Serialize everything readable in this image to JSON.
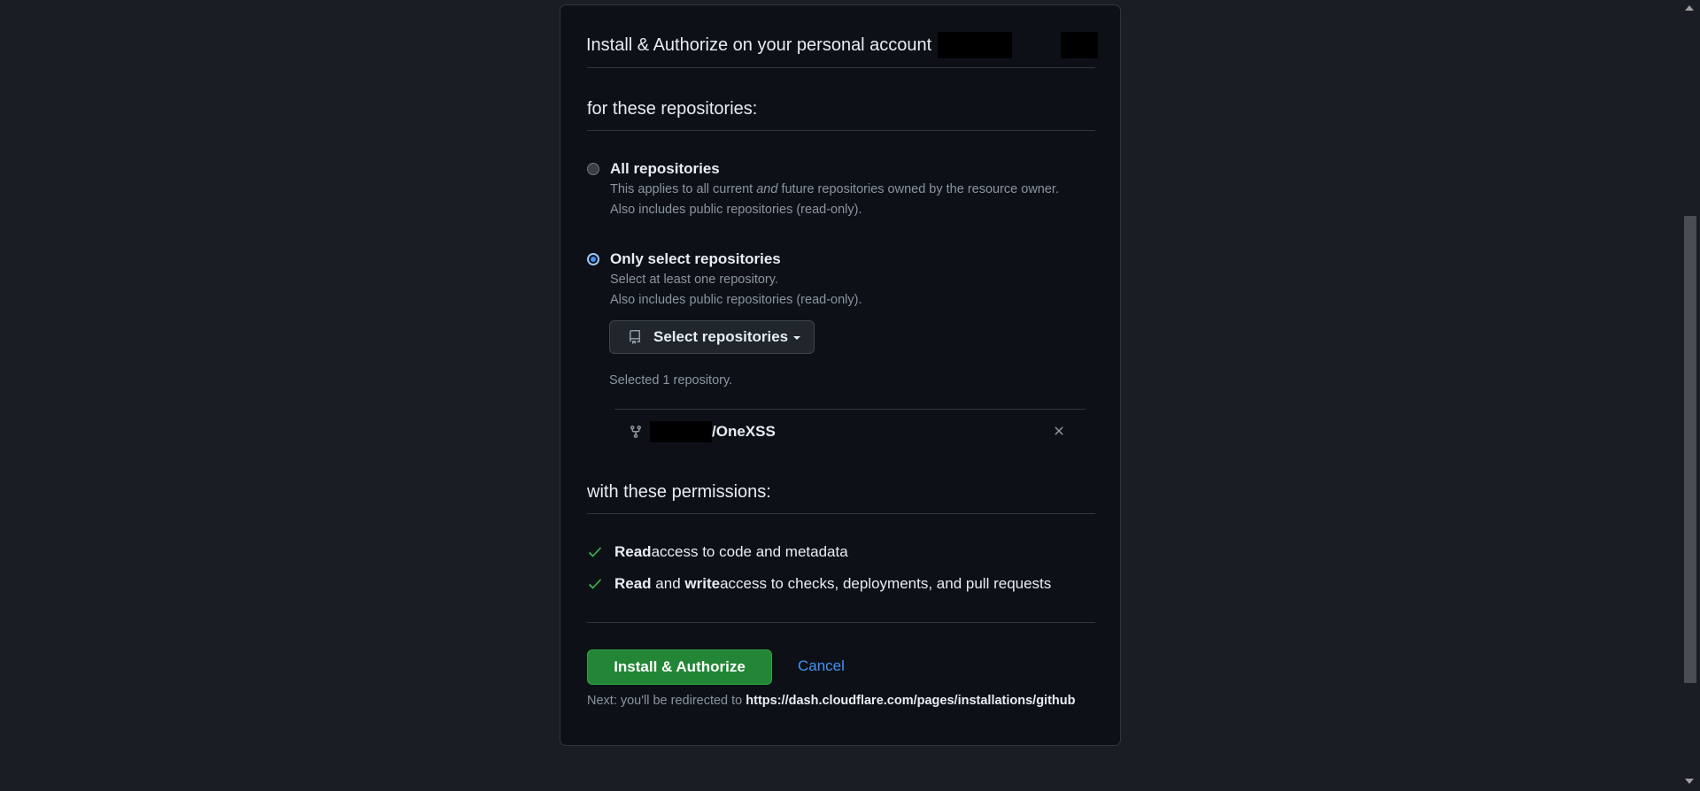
{
  "header": {
    "title": "Install & Authorize on your personal account"
  },
  "repositories": {
    "section_title": "for these repositories:",
    "all_option": {
      "label": "All repositories",
      "desc_part1": "This applies to all current ",
      "desc_em": "and",
      "desc_part2": " future repositories owned by the resource owner.",
      "desc_line2": "Also includes public repositories (read-only).",
      "selected": false
    },
    "select_option": {
      "label": "Only select repositories",
      "desc_line1": "Select at least one repository.",
      "desc_line2": "Also includes public repositories (read-only).",
      "selected": true
    },
    "select_button_label": "Select repositories",
    "selected_count_text": "Selected 1 repository.",
    "selected_items": [
      {
        "name": "/OneXSS"
      }
    ]
  },
  "permissions": {
    "section_title": "with these permissions:",
    "items": [
      {
        "bold1": "Read",
        "mid": "",
        "bold2": "",
        "rest": " access to code and metadata"
      },
      {
        "bold1": "Read",
        "mid": " and ",
        "bold2": "write",
        "rest": " access to checks, deployments, and pull requests"
      }
    ]
  },
  "actions": {
    "install_label": "Install & Authorize",
    "cancel_label": "Cancel",
    "redirect_prefix": "Next: you'll be redirected to ",
    "redirect_url": "https://dash.cloudflare.com/pages/installations/github"
  },
  "colors": {
    "background": "#1a1d23",
    "card": "#0d1117",
    "accent_blue": "#4493f8",
    "install_green": "#238636",
    "check_green": "#3fb950"
  },
  "icons": {
    "repo": "repo-icon",
    "fork": "repo-forked-icon",
    "remove": "x-icon",
    "check": "check-icon",
    "caret": "triangle-down-icon"
  }
}
